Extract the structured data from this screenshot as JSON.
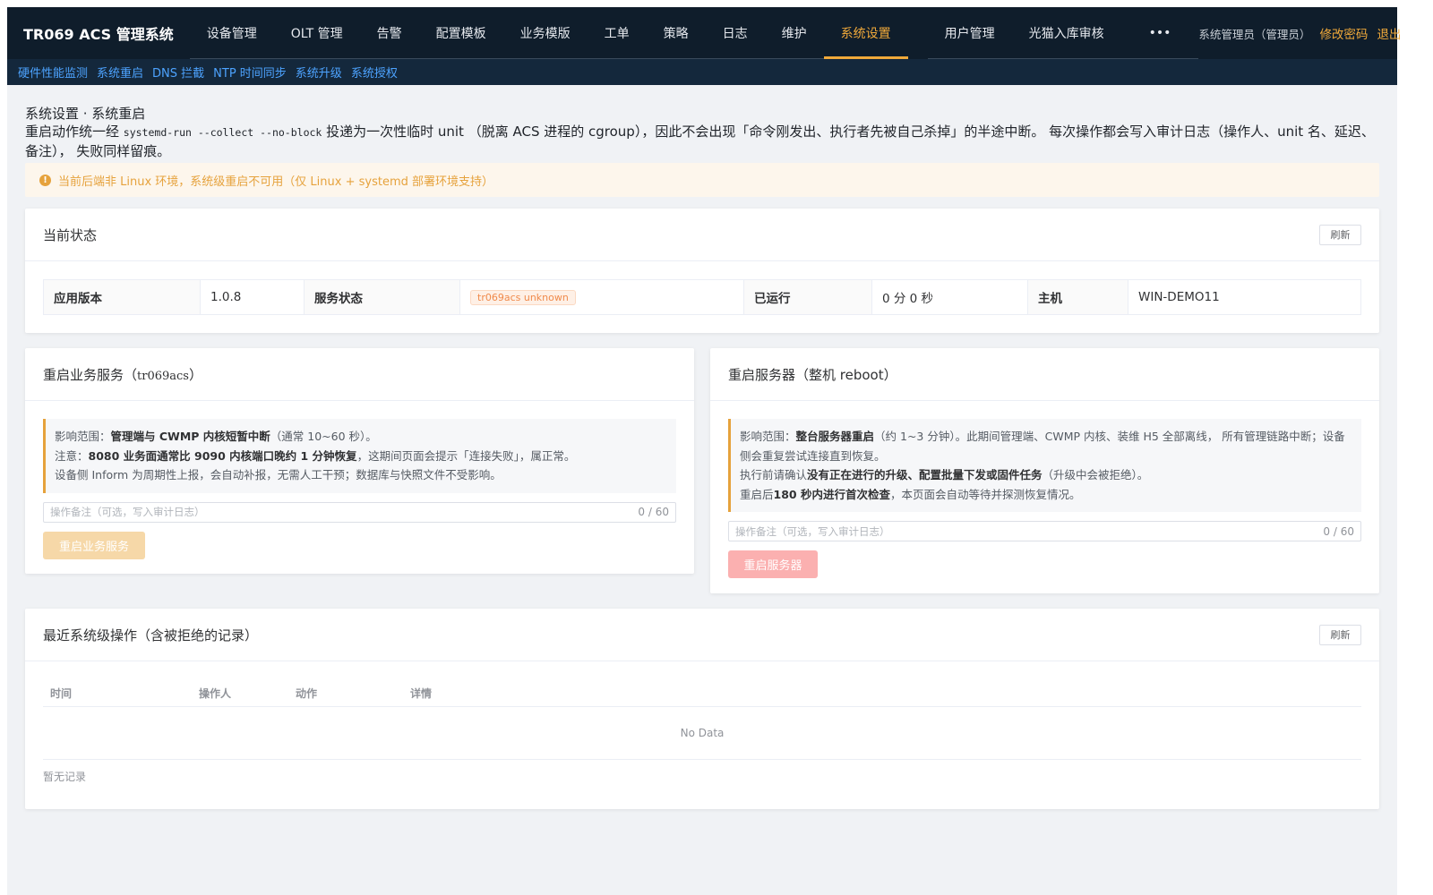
{
  "app": {
    "title": "TR069 ACS 管理系统"
  },
  "nav": {
    "items": [
      "设备管理",
      "OLT 管理",
      "告警",
      "配置模板",
      "业务模版",
      "工单",
      "策略",
      "日志",
      "维护",
      "系统设置"
    ],
    "items_right": [
      "用户管理",
      "光猫入库审核"
    ],
    "more": "•••",
    "active_index": 9,
    "user": "系统管理员（管理员）",
    "change_password": "修改密码",
    "logout": "退出"
  },
  "subnav": {
    "items": [
      "硬件性能监测",
      "系统重启",
      "DNS 拦截",
      "NTP 时间同步",
      "系统升级",
      "系统授权"
    ]
  },
  "page": {
    "breadcrumb": "系统设置 · 系统重启",
    "desc_pre": "重启动作统一经 ",
    "desc_code": "systemd-run --collect --no-block",
    "desc_post": " 投递为一次性临时 unit （脱离 ACS 进程的 cgroup），因此不会出现「命令刚发出、执行者先被自己杀掉」的半途中断。 每次操作都会写入审计日志（操作人、unit 名、延迟、备注）， 失败同样留痕。",
    "alert": "当前后端非 Linux 环境，系统级重启不可用（仅 Linux + systemd 部署环境支持）"
  },
  "status": {
    "title": "当前状态",
    "refresh": "刷新",
    "app_version_label": "应用版本",
    "app_version": "1.0.8",
    "service_status_label": "服务状态",
    "service_status": "tr069acs unknown",
    "uptime_label": "已运行",
    "uptime": "0 分 0 秒",
    "host_label": "主机",
    "host": "WIN-DEMO11"
  },
  "restart_service": {
    "title": "重启业务服务（",
    "title_code": "tr069acs",
    "title_end": "）",
    "l1_pre": "影响范围：",
    "l1_bold": "管理端与 CWMP 内核短暂中断",
    "l1_post": "（通常 10~60 秒）。",
    "l2_pre": "注意：",
    "l2_bold": "8080 业务面通常比 9090 内核端口晚约 1 分钟恢复",
    "l2_post": "，这期间页面会提示「连接失败」，属正常。",
    "l3": "设备侧 Inform 为周期性上报，会自动补报，无需人工干预；数据库与快照文件不受影响。",
    "placeholder": "操作备注（可选，写入审计日志）",
    "counter": "0 / 60",
    "button": "重启业务服务"
  },
  "restart_server": {
    "title": "重启服务器（整机 reboot）",
    "l1_pre": "影响范围：",
    "l1_bold": "整台服务器重启",
    "l1_post": "（约 1~3 分钟）。此期间管理端、CWMP 内核、装维 H5 全部离线， 所有管理链路中断；设备侧会重复尝试连接直到恢复。",
    "l2_pre": "执行前请确认",
    "l2_bold": "没有正在进行的升级、配置批量下发或固件任务",
    "l2_post": "（升级中会被拒绝）。",
    "l3_pre": "重启后",
    "l3_bold": "180 秒内进行首次检查",
    "l3_post": "，本页面会自动等待并探测恢复情况。",
    "placeholder": "操作备注（可选，写入审计日志）",
    "counter": "0 / 60",
    "button": "重启服务器"
  },
  "log": {
    "title": "最近系统级操作（含被拒绝的记录）",
    "refresh": "刷新",
    "columns": [
      "时间",
      "操作人",
      "动作",
      "详情"
    ],
    "empty": "No Data",
    "footer": "暂无记录"
  },
  "colors": {
    "accent": "#f0a93a",
    "nav_bg": "#0f1d2b",
    "subnav_link": "#4da3ff",
    "warn": "#e6a23c"
  }
}
